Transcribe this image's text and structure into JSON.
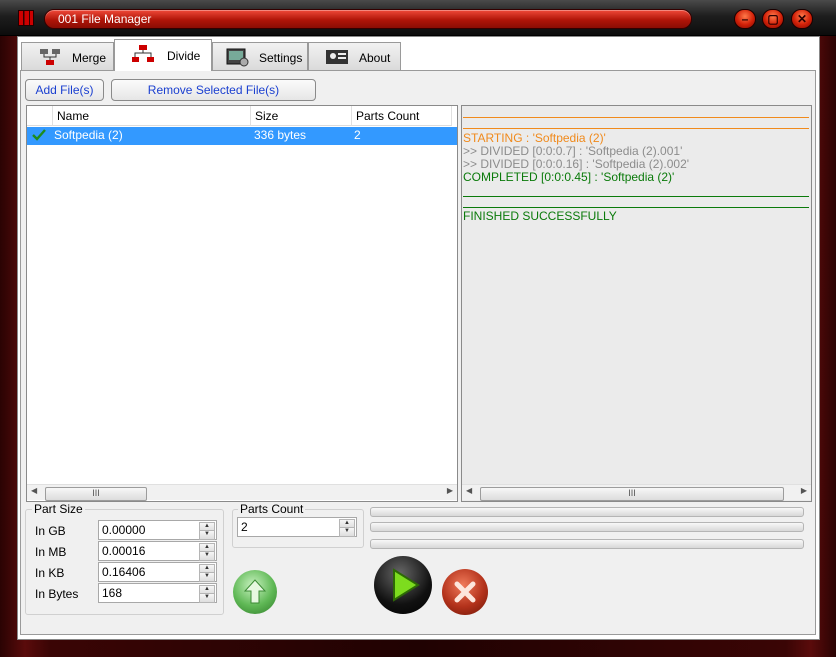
{
  "window": {
    "title": "001 File Manager",
    "buttons": {
      "minimize": "–",
      "maximize": "▢",
      "close": "✕"
    }
  },
  "tabs": [
    {
      "label": "Merge",
      "icon": "merge-icon"
    },
    {
      "label": "Divide",
      "icon": "divide-icon",
      "active": true
    },
    {
      "label": "Settings",
      "icon": "settings-icon"
    },
    {
      "label": "About",
      "icon": "about-icon"
    }
  ],
  "toolbar": {
    "add_label": "Add File(s)",
    "remove_label": "Remove Selected File(s)"
  },
  "file_table": {
    "columns": [
      "Name",
      "Size",
      "Parts Count"
    ],
    "rows": [
      {
        "status_icon": "check-icon",
        "name": "Softpedia (2)",
        "size": "336 bytes",
        "parts": "2"
      }
    ],
    "scroll_grip": "III"
  },
  "log": {
    "lines": [
      {
        "text": "STARTING : 'Softpedia (2)'",
        "color": "#f08a1c"
      },
      {
        "text": ">> DIVIDED [0:0:0.7] : 'Softpedia (2).001'",
        "color": "#8c8c8c"
      },
      {
        "text": ">> DIVIDED [0:0:0.16] : 'Softpedia (2).002'",
        "color": "#8c8c8c"
      },
      {
        "text": "COMPLETED [0:0:0.45] : 'Softpedia (2)'",
        "color": "#0a7a0a"
      },
      {
        "text": "FINISHED SUCCESSFULLY",
        "color": "#0a7a0a"
      }
    ],
    "scroll_grip": "III"
  },
  "part_size": {
    "title": "Part Size",
    "fields": [
      {
        "label": "In GB",
        "value": "0.00000"
      },
      {
        "label": "In MB",
        "value": "0.00016"
      },
      {
        "label": "In KB",
        "value": "0.16406"
      },
      {
        "label": "In Bytes",
        "value": "168"
      }
    ]
  },
  "parts_count": {
    "title": "Parts Count",
    "value": "2"
  },
  "progress": [
    0,
    0,
    0
  ],
  "actions": {
    "upload": "up-arrow-icon",
    "start": "play-icon",
    "cancel": "cancel-icon"
  },
  "colors": {
    "accent": "#c4190a",
    "selection": "#3399ff",
    "link": "#1a3fd0"
  }
}
